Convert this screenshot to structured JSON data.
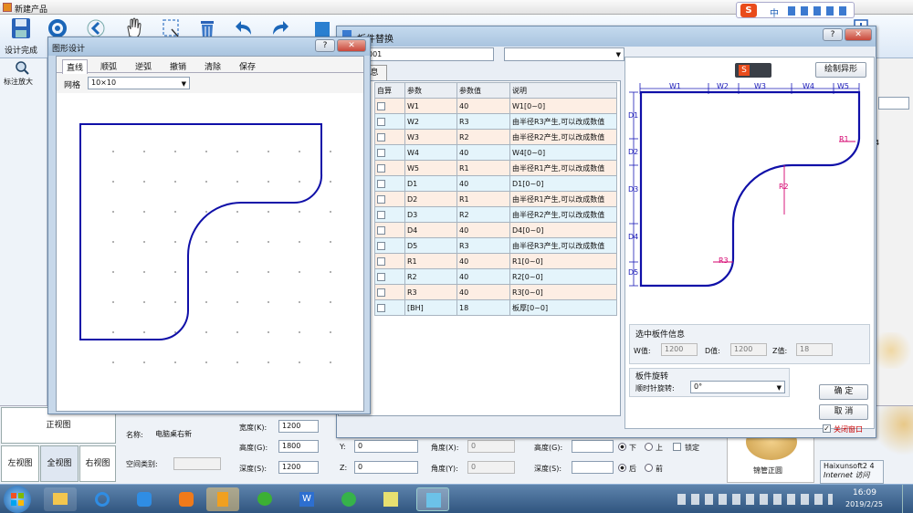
{
  "app": {
    "title": "新建产品"
  },
  "toolbar": {
    "buttons": [
      {
        "label": "设计完成",
        "icon": "save-icon"
      }
    ]
  },
  "left_toolbar": {
    "zoom_label": "标注放大"
  },
  "bottom_panel": {
    "views": {
      "front": "正视图",
      "left": "左视图",
      "full": "全视图",
      "right": "右视图"
    },
    "name_label": "名称:",
    "name_value": "电脑桌右新",
    "space_label": "空间类别:",
    "width_label": "宽度(K):",
    "width_value": "1200",
    "height_label": "高度(G):",
    "height_value": "1800",
    "depth_label": "深度(S):",
    "depth_value": "1200",
    "y_label": "Y:",
    "y_value": "0",
    "z_label": "Z:",
    "z_value": "0",
    "angle_x_label": "角度(X):",
    "angle_x_value": "0",
    "angle_y_label": "角度(Y):",
    "angle_y_value": "0",
    "height2_label": "高度(G):",
    "depth2_label": "深度(S):",
    "radio_down": "下",
    "radio_up": "上",
    "lock_label": "锁定",
    "radio_back": "后",
    "radio_front": "前",
    "thumb_label": "锦管正圆"
  },
  "shape_design_window": {
    "title": "图形设计",
    "tabs": [
      "直线",
      "顺弧",
      "逆弧",
      "撤销",
      "清除",
      "保存"
    ],
    "grid_label": "网格",
    "grid_value": "10×10"
  },
  "board_replace_window": {
    "title": "板件替换",
    "code_value": "001",
    "panel_tab": "息",
    "draw_button": "绘制异形",
    "table": {
      "headers": [
        "自算",
        "参数",
        "参数值",
        "说明"
      ],
      "rows": [
        {
          "param": "W1",
          "value": "40",
          "desc": "W1[0~0]"
        },
        {
          "param": "W2",
          "value": "R3",
          "desc": "由半径R3产生,可以改成数值"
        },
        {
          "param": "W3",
          "value": "R2",
          "desc": "由半径R2产生,可以改成数值"
        },
        {
          "param": "W4",
          "value": "40",
          "desc": "W4[0~0]"
        },
        {
          "param": "W5",
          "value": "R1",
          "desc": "由半径R1产生,可以改成数值"
        },
        {
          "param": "D1",
          "value": "40",
          "desc": "D1[0~0]"
        },
        {
          "param": "D2",
          "value": "R1",
          "desc": "由半径R1产生,可以改成数值"
        },
        {
          "param": "D3",
          "value": "R2",
          "desc": "由半径R2产生,可以改成数值"
        },
        {
          "param": "D4",
          "value": "40",
          "desc": "D4[0~0]"
        },
        {
          "param": "D5",
          "value": "R3",
          "desc": "由半径R3产生,可以改成数值"
        },
        {
          "param": "R1",
          "value": "40",
          "desc": "R1[0~0]"
        },
        {
          "param": "R2",
          "value": "40",
          "desc": "R2[0~0]"
        },
        {
          "param": "R3",
          "value": "40",
          "desc": "R3[0~0]"
        },
        {
          "param": "[BH]",
          "value": "18",
          "desc": "板厚[0~0]"
        }
      ]
    },
    "diagram_labels": {
      "w": [
        "W1",
        "W2",
        "W3",
        "W4",
        "W5"
      ],
      "d": [
        "D1",
        "D2",
        "D3",
        "D4",
        "D5"
      ],
      "r": [
        "R1",
        "R2",
        "R3"
      ]
    },
    "info_title": "选中板件信息",
    "w_label": "W值:",
    "w_value": "1200",
    "d_label": "D值:",
    "d_value": "1200",
    "z_label": "Z值:",
    "z_value": "18",
    "rotate_title": "板件旋转",
    "rotate_label": "顺时针旋转:",
    "rotate_value": "0°",
    "ok_button": "确 定",
    "cancel_button": "取 消",
    "close_window_label": "关闭窗口"
  },
  "ime": {
    "mode": "中"
  },
  "tooltip": {
    "line1": "Haixunsoft2  4",
    "line2": "Internet 访问"
  },
  "taskbar": {
    "time": "16:09",
    "date": "2019/2/25"
  },
  "colors": {
    "shape": "#1010a8",
    "radius": "#d4006e",
    "dimension": "#1a1ab8"
  }
}
